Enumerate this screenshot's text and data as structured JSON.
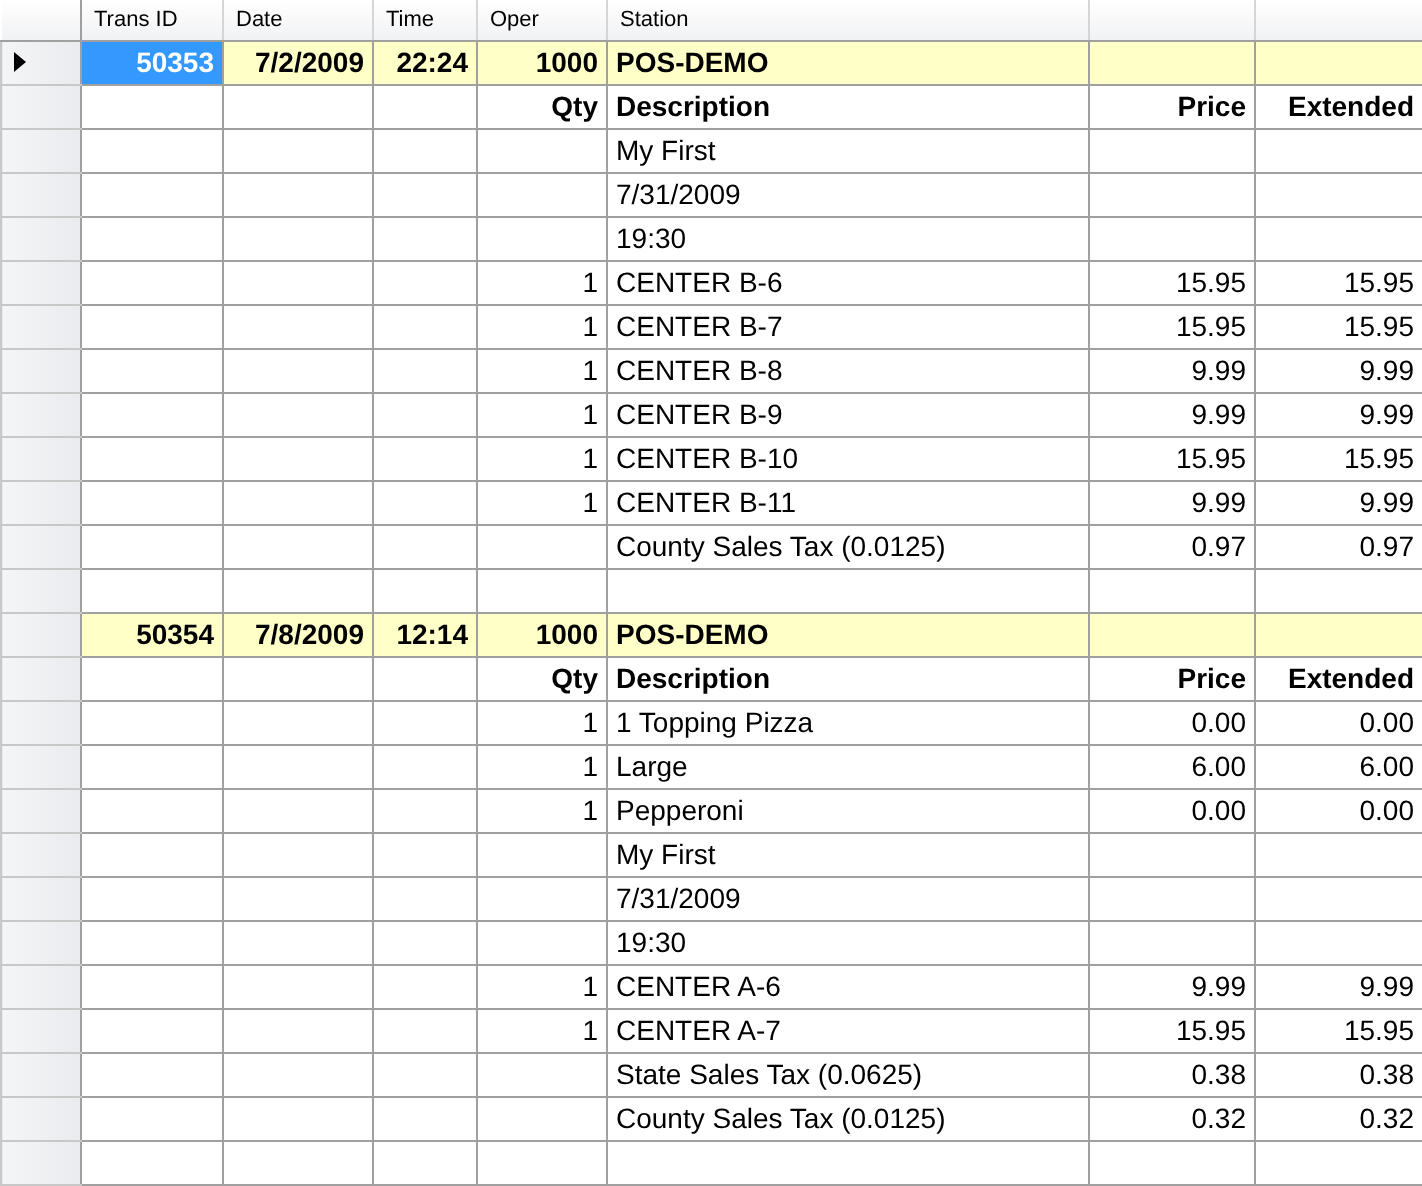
{
  "columns": [
    {
      "label": "Trans ID"
    },
    {
      "label": "Date"
    },
    {
      "label": "Time"
    },
    {
      "label": "Oper"
    },
    {
      "label": "Station"
    }
  ],
  "rows": [
    {
      "kind": "transaction",
      "selected": true,
      "trans_id": "50353",
      "date": "7/2/2009",
      "time": "22:24",
      "oper": "1000",
      "station": "POS-DEMO"
    },
    {
      "kind": "detail_header",
      "selected": false,
      "qty": "Qty",
      "description": "Description",
      "price": "Price",
      "extended": "Extended"
    },
    {
      "kind": "line",
      "selected": false,
      "description": "My First"
    },
    {
      "kind": "line",
      "selected": false,
      "description": "7/31/2009"
    },
    {
      "kind": "line",
      "selected": false,
      "description": "19:30"
    },
    {
      "kind": "line",
      "selected": false,
      "qty": "1",
      "description": "CENTER B-6",
      "price": "15.95",
      "extended": "15.95"
    },
    {
      "kind": "line",
      "selected": false,
      "qty": "1",
      "description": "CENTER B-7",
      "price": "15.95",
      "extended": "15.95"
    },
    {
      "kind": "line",
      "selected": false,
      "qty": "1",
      "description": "CENTER B-8",
      "price": "9.99",
      "extended": "9.99"
    },
    {
      "kind": "line",
      "selected": false,
      "qty": "1",
      "description": "CENTER B-9",
      "price": "9.99",
      "extended": "9.99"
    },
    {
      "kind": "line",
      "selected": false,
      "qty": "1",
      "description": "CENTER B-10",
      "price": "15.95",
      "extended": "15.95"
    },
    {
      "kind": "line",
      "selected": false,
      "qty": "1",
      "description": "CENTER B-11",
      "price": "9.99",
      "extended": "9.99"
    },
    {
      "kind": "line",
      "selected": false,
      "description": "County Sales Tax (0.0125)",
      "price": "0.97",
      "extended": "0.97"
    },
    {
      "kind": "blank",
      "selected": false
    },
    {
      "kind": "transaction",
      "selected": false,
      "trans_id": "50354",
      "date": "7/8/2009",
      "time": "12:14",
      "oper": "1000",
      "station": "POS-DEMO"
    },
    {
      "kind": "detail_header",
      "selected": false,
      "qty": "Qty",
      "description": "Description",
      "price": "Price",
      "extended": "Extended"
    },
    {
      "kind": "line",
      "selected": false,
      "qty": "1",
      "description": "1 Topping Pizza",
      "price": "0.00",
      "extended": "0.00"
    },
    {
      "kind": "line",
      "selected": false,
      "qty": "1",
      "description": "Large",
      "price": "6.00",
      "extended": "6.00"
    },
    {
      "kind": "line",
      "selected": false,
      "qty": "1",
      "description": "Pepperoni",
      "price": "0.00",
      "extended": "0.00"
    },
    {
      "kind": "line",
      "selected": false,
      "description": "My First"
    },
    {
      "kind": "line",
      "selected": false,
      "description": "7/31/2009"
    },
    {
      "kind": "line",
      "selected": false,
      "description": "19:30"
    },
    {
      "kind": "line",
      "selected": false,
      "qty": "1",
      "description": "CENTER A-6",
      "price": "9.99",
      "extended": "9.99"
    },
    {
      "kind": "line",
      "selected": false,
      "qty": "1",
      "description": "CENTER A-7",
      "price": "15.95",
      "extended": "15.95"
    },
    {
      "kind": "line",
      "selected": false,
      "description": "State Sales Tax (0.0625)",
      "price": "0.38",
      "extended": "0.38"
    },
    {
      "kind": "line",
      "selected": false,
      "description": "County Sales Tax (0.0125)",
      "price": "0.32",
      "extended": "0.32"
    },
    {
      "kind": "blank",
      "selected": false
    }
  ]
}
